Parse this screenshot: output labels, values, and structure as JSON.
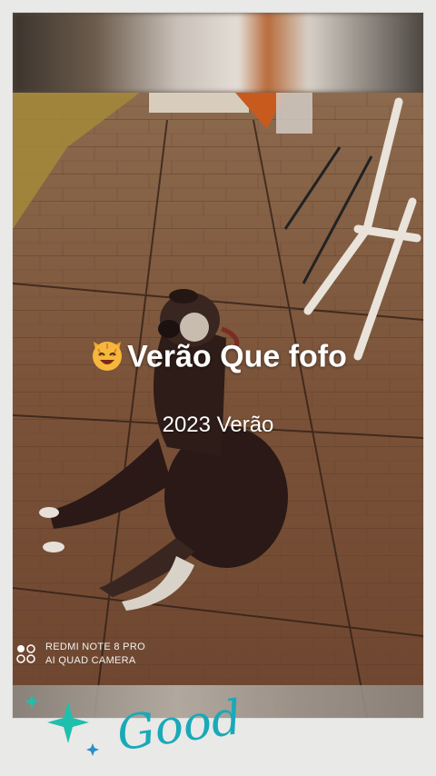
{
  "caption": {
    "title": "Verão Que fofo",
    "subtitle": "2023 Verão"
  },
  "watermark": {
    "line1": "REDMI NOTE 8 PRO",
    "line2": "AI QUAD CAMERA"
  },
  "decoration": {
    "script_text": "Good"
  },
  "icons": [
    "cat-face-emoji-icon",
    "camera-circles-icon",
    "sparkle-star-icon"
  ],
  "colors": {
    "caption": "#ffffff",
    "sparkle": "#1fbfae",
    "script": "#1aa9b8",
    "background": "#e9e9e7"
  }
}
